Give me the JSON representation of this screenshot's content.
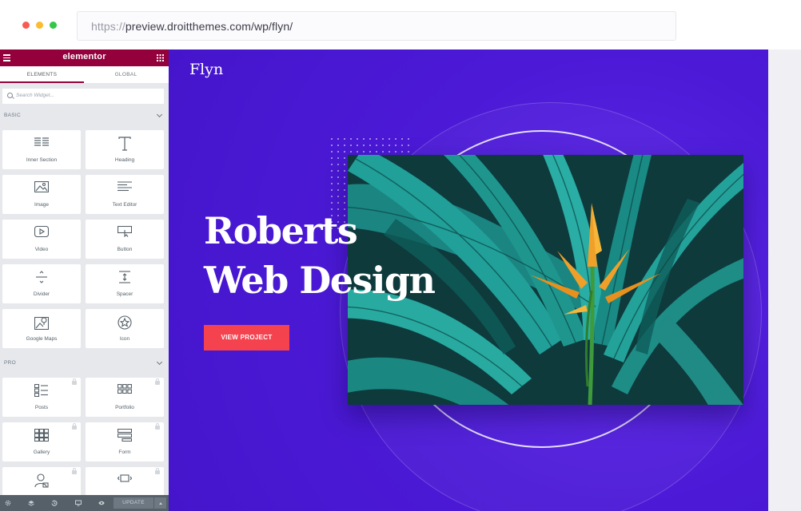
{
  "browser": {
    "url_protocol": "https://",
    "url_path": "preview.droitthemes.com/wp/flyn/"
  },
  "editor": {
    "brand": "elementor",
    "tabs": [
      "ELEMENTS",
      "GLOBAL"
    ],
    "search_placeholder": "Search Widget...",
    "sections": {
      "basic": "BASIC",
      "pro": "PRO"
    },
    "basic_widgets": [
      {
        "label": "Inner Section",
        "icon": "inner-section-icon"
      },
      {
        "label": "Heading",
        "icon": "heading-icon"
      },
      {
        "label": "Image",
        "icon": "image-icon"
      },
      {
        "label": "Text Editor",
        "icon": "text-editor-icon"
      },
      {
        "label": "Video",
        "icon": "video-icon"
      },
      {
        "label": "Button",
        "icon": "button-icon"
      },
      {
        "label": "Divider",
        "icon": "divider-icon"
      },
      {
        "label": "Spacer",
        "icon": "spacer-icon"
      },
      {
        "label": "Google Maps",
        "icon": "google-maps-icon"
      },
      {
        "label": "Icon",
        "icon": "star-icon"
      }
    ],
    "pro_widgets": [
      {
        "label": "Posts",
        "icon": "posts-icon"
      },
      {
        "label": "Portfolio",
        "icon": "portfolio-icon"
      },
      {
        "label": "Gallery",
        "icon": "gallery-icon"
      },
      {
        "label": "Form",
        "icon": "form-icon"
      },
      {
        "label": "",
        "icon": "login-icon"
      },
      {
        "label": "",
        "icon": "slides-icon"
      }
    ],
    "update_label": "UPDATE",
    "accent": "#93003c"
  },
  "site": {
    "logo": "Flyn",
    "headline_line1": "Roberts",
    "headline_line2": "Web Design",
    "cta_label": "VIEW PROJECT",
    "accent": "#f5424f",
    "background": "#4c1ad7"
  }
}
